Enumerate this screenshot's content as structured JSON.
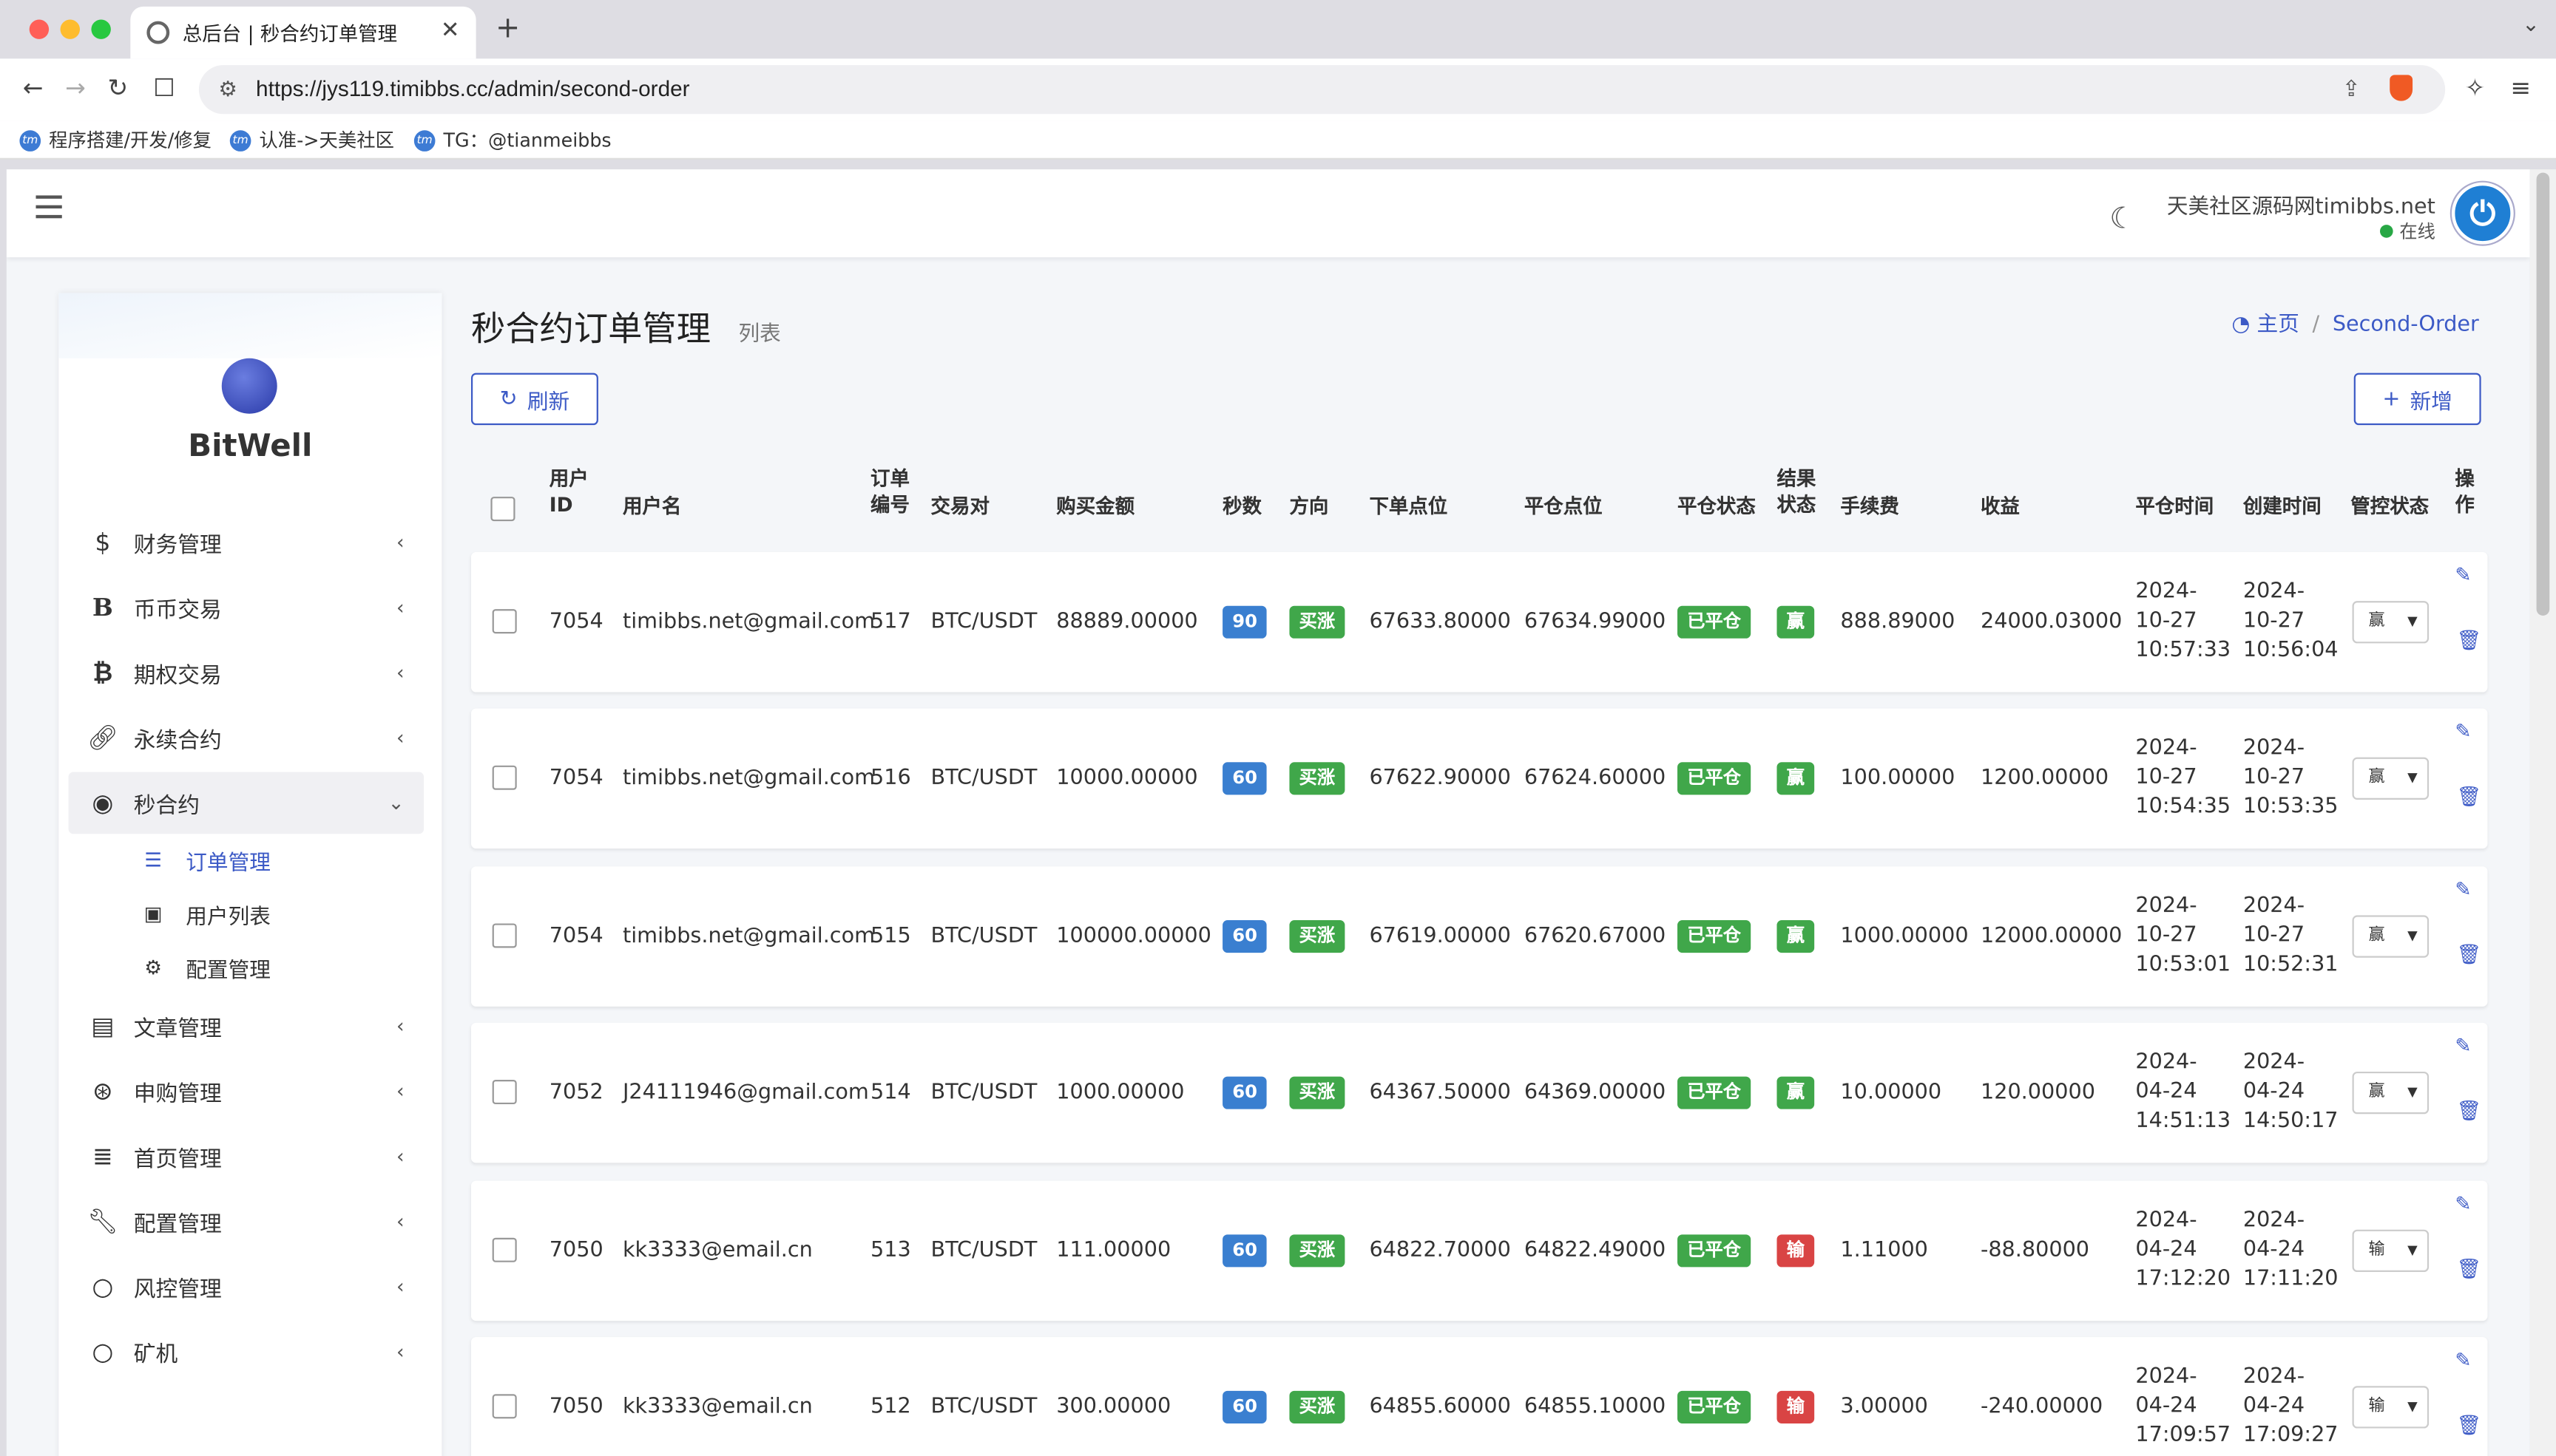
{
  "browser": {
    "tab_title": "总后台 | 秒合约订单管理",
    "url": "https://jys119.timibbs.cc/admin/second-order",
    "bookmarks": [
      "程序搭建/开发/修复",
      "认准->天美社区",
      "TG：@tianmeibbs"
    ],
    "colors": {
      "close": "#ff5f57",
      "min": "#febc2e",
      "max": "#28c840"
    }
  },
  "header": {
    "user_name": "天美社区源码网timibbs.net",
    "status": "在线"
  },
  "sidebar": {
    "logo": "BitWell",
    "items": [
      {
        "label": "财务管理",
        "icon": "dollar-icon"
      },
      {
        "label": "币币交易",
        "icon": "bold-b-icon"
      },
      {
        "label": "期权交易",
        "icon": "bitcoin-icon"
      },
      {
        "label": "永续合约",
        "icon": "link-icon"
      },
      {
        "label": "秒合约",
        "icon": "dot-circle-icon"
      },
      {
        "label": "文章管理",
        "icon": "newspaper-icon"
      },
      {
        "label": "申购管理",
        "icon": "lifering-icon"
      },
      {
        "label": "首页管理",
        "icon": "list-icon"
      },
      {
        "label": "配置管理",
        "icon": "wrench-icon"
      },
      {
        "label": "风控管理",
        "icon": "circle-icon"
      },
      {
        "label": "矿机",
        "icon": "circle-icon"
      }
    ],
    "sub_items": [
      {
        "label": "订单管理",
        "icon": "bars-icon"
      },
      {
        "label": "用户列表",
        "icon": "id-card-icon"
      },
      {
        "label": "配置管理",
        "icon": "gear-icon"
      }
    ]
  },
  "content": {
    "title": "秒合约订单管理",
    "subtitle": "列表",
    "breadcrumb_home": "主页",
    "breadcrumb_current": "Second-Order",
    "refresh_label": "刷新",
    "add_label": "新增"
  },
  "table": {
    "headers": {
      "uid1": "用户",
      "uid2": "ID",
      "username": "用户名",
      "no1": "订单",
      "no2": "编号",
      "pair": "交易对",
      "amount": "购买金额",
      "seconds": "秒数",
      "direction": "方向",
      "open_price": "下单点位",
      "close_price": "平仓点位",
      "close_status": "平仓状态",
      "result1": "结果",
      "result2": "状态",
      "fee": "手续费",
      "profit": "收益",
      "close_time": "平仓时间",
      "create_time": "创建时间",
      "control": "管控状态",
      "op1": "操",
      "op2": "作"
    },
    "rows": [
      {
        "uid": "7054",
        "username": "timibbs.net@gmail.com",
        "no": "517",
        "pair": "BTC/USDT",
        "amount": "88889.00000",
        "seconds": "90",
        "direction": "买涨",
        "open_price": "67633.80000",
        "close_price": "67634.99000",
        "close_status": "已平仓",
        "result": "赢",
        "fee": "888.89000",
        "profit": "24000.03000",
        "close_time": [
          "2024-",
          "10-27",
          "10:57:33"
        ],
        "create_time": [
          "2024-",
          "10-27",
          "10:56:04"
        ],
        "control": "赢"
      },
      {
        "uid": "7054",
        "username": "timibbs.net@gmail.com",
        "no": "516",
        "pair": "BTC/USDT",
        "amount": "10000.00000",
        "seconds": "60",
        "direction": "买涨",
        "open_price": "67622.90000",
        "close_price": "67624.60000",
        "close_status": "已平仓",
        "result": "赢",
        "fee": "100.00000",
        "profit": "1200.00000",
        "close_time": [
          "2024-",
          "10-27",
          "10:54:35"
        ],
        "create_time": [
          "2024-",
          "10-27",
          "10:53:35"
        ],
        "control": "赢"
      },
      {
        "uid": "7054",
        "username": "timibbs.net@gmail.com",
        "no": "515",
        "pair": "BTC/USDT",
        "amount": "100000.00000",
        "seconds": "60",
        "direction": "买涨",
        "open_price": "67619.00000",
        "close_price": "67620.67000",
        "close_status": "已平仓",
        "result": "赢",
        "fee": "1000.00000",
        "profit": "12000.00000",
        "close_time": [
          "2024-",
          "10-27",
          "10:53:01"
        ],
        "create_time": [
          "2024-",
          "10-27",
          "10:52:31"
        ],
        "control": "赢"
      },
      {
        "uid": "7052",
        "username": "J24111946@gmail.com",
        "no": "514",
        "pair": "BTC/USDT",
        "amount": "1000.00000",
        "seconds": "60",
        "direction": "买涨",
        "open_price": "64367.50000",
        "close_price": "64369.00000",
        "close_status": "已平仓",
        "result": "赢",
        "fee": "10.00000",
        "profit": "120.00000",
        "close_time": [
          "2024-",
          "04-24",
          "14:51:13"
        ],
        "create_time": [
          "2024-",
          "04-24",
          "14:50:17"
        ],
        "control": "赢"
      },
      {
        "uid": "7050",
        "username": "kk3333@email.cn",
        "no": "513",
        "pair": "BTC/USDT",
        "amount": "111.00000",
        "seconds": "60",
        "direction": "买涨",
        "open_price": "64822.70000",
        "close_price": "64822.49000",
        "close_status": "已平仓",
        "result": "输",
        "fee": "1.11000",
        "profit": "-88.80000",
        "close_time": [
          "2024-",
          "04-24",
          "17:12:20"
        ],
        "create_time": [
          "2024-",
          "04-24",
          "17:11:20"
        ],
        "control": "输"
      },
      {
        "uid": "7050",
        "username": "kk3333@email.cn",
        "no": "512",
        "pair": "BTC/USDT",
        "amount": "300.00000",
        "seconds": "60",
        "direction": "买涨",
        "open_price": "64855.60000",
        "close_price": "64855.10000",
        "close_status": "已平仓",
        "result": "输",
        "fee": "3.00000",
        "profit": "-240.00000",
        "close_time": [
          "2024-",
          "04-24",
          "17:09:57"
        ],
        "create_time": [
          "2024-",
          "04-24",
          "17:09:27"
        ],
        "control": "输"
      }
    ]
  }
}
